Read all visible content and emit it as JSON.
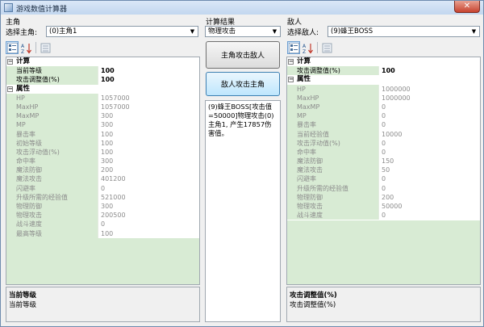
{
  "window": {
    "title": "游戏数值计算器",
    "close_label": "✕"
  },
  "hero": {
    "section_label": "主角",
    "select_label": "选择主角:",
    "selected": "(0)主角1",
    "grid": [
      {
        "type": "category",
        "label": "计算"
      },
      {
        "key": "当前等级",
        "value": "100",
        "bold": true
      },
      {
        "key": "攻击调整值(%)",
        "value": "100",
        "bold": true,
        "selected": true
      },
      {
        "type": "category",
        "label": "属性"
      },
      {
        "key": "HP",
        "value": "1057000",
        "ro": true
      },
      {
        "key": "MaxHP",
        "value": "1057000",
        "ro": true
      },
      {
        "key": "MaxMP",
        "value": "300",
        "ro": true
      },
      {
        "key": "MP",
        "value": "300",
        "ro": true
      },
      {
        "key": "暴击率",
        "value": "100",
        "ro": true
      },
      {
        "key": "初始等级",
        "value": "100",
        "ro": true
      },
      {
        "key": "攻击浮动值(%)",
        "value": "100",
        "ro": true
      },
      {
        "key": "命中率",
        "value": "300",
        "ro": true
      },
      {
        "key": "魔法防御",
        "value": "200",
        "ro": true
      },
      {
        "key": "魔法攻击",
        "value": "401200",
        "ro": true
      },
      {
        "key": "闪避率",
        "value": "0",
        "ro": true
      },
      {
        "key": "升级所需的经验值",
        "value": "521000",
        "ro": true
      },
      {
        "key": "物理防御",
        "value": "300",
        "ro": true
      },
      {
        "key": "物理攻击",
        "value": "200500",
        "ro": true
      },
      {
        "key": "战斗速度",
        "value": "0",
        "ro": true
      },
      {
        "key": "最高等级",
        "value": "100",
        "ro": true
      }
    ],
    "desc_title": "当前等级",
    "desc_text": "当前等级"
  },
  "result": {
    "section_label": "计算结果",
    "mode": "物理攻击",
    "hero_attack_label": "主角攻击敌人",
    "enemy_attack_label": "敌人攻击主角",
    "text": "(9)蜂王BOSS[攻击值=50000]物理攻击(0)主角1, 产生17857伤害值。"
  },
  "enemy": {
    "section_label": "敌人",
    "select_label": "选择敌人:",
    "selected": "(9)蜂王BOSS",
    "grid": [
      {
        "type": "category",
        "label": "计算"
      },
      {
        "key": "攻击调整值(%)",
        "value": "100",
        "bold": true
      },
      {
        "type": "category",
        "label": "属性"
      },
      {
        "key": "HP",
        "value": "1000000",
        "ro": true
      },
      {
        "key": "MaxHP",
        "value": "1000000",
        "ro": true
      },
      {
        "key": "MaxMP",
        "value": "0",
        "ro": true
      },
      {
        "key": "MP",
        "value": "0",
        "ro": true
      },
      {
        "key": "暴击率",
        "value": "0",
        "ro": true
      },
      {
        "key": "当前经验值",
        "value": "10000",
        "ro": true
      },
      {
        "key": "攻击浮动值(%)",
        "value": "0",
        "ro": true
      },
      {
        "key": "命中率",
        "value": "0",
        "ro": true
      },
      {
        "key": "魔法防御",
        "value": "150",
        "ro": true
      },
      {
        "key": "魔法攻击",
        "value": "50",
        "ro": true
      },
      {
        "key": "闪避率",
        "value": "0",
        "ro": true
      },
      {
        "key": "升级所需的经验值",
        "value": "0",
        "ro": true
      },
      {
        "key": "物理防御",
        "value": "200",
        "ro": true
      },
      {
        "key": "物理攻击",
        "value": "50000",
        "ro": true
      },
      {
        "key": "战斗速度",
        "value": "0",
        "ro": true
      }
    ],
    "desc_title": "攻击调整值(%)",
    "desc_text": "攻击调整值(%)"
  }
}
